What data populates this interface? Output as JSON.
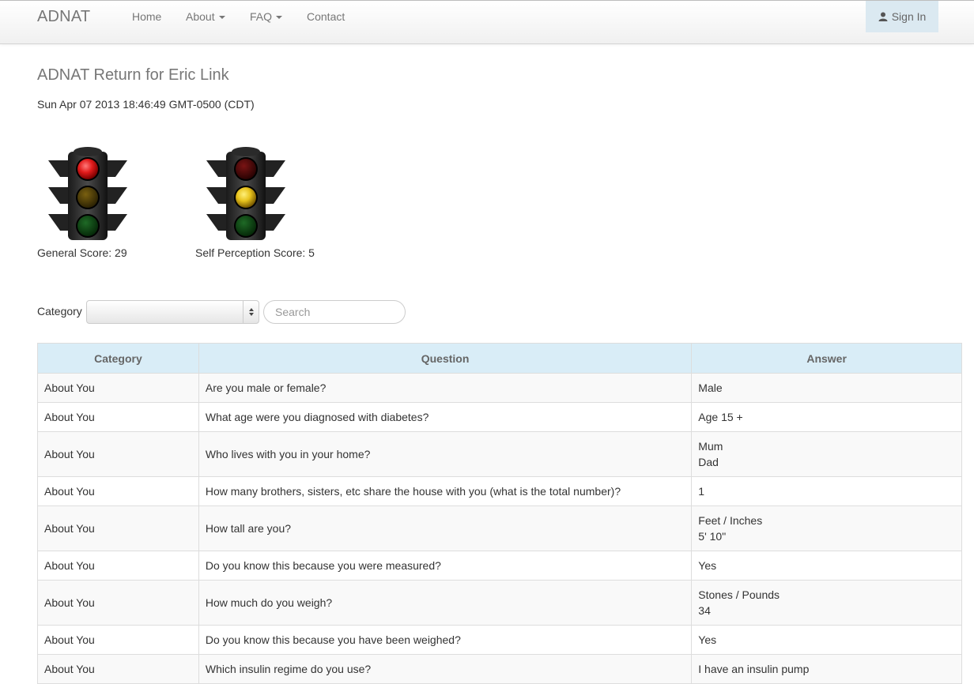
{
  "navbar": {
    "brand": "ADNAT",
    "home": "Home",
    "about": "About",
    "faq": "FAQ",
    "contact": "Contact",
    "sign_in": "Sign In"
  },
  "page": {
    "title": "ADNAT Return for Eric Link",
    "timestamp": "Sun Apr 07 2013 18:46:49 GMT-0500 (CDT)"
  },
  "scores": {
    "general": {
      "label": "General Score: 29",
      "active_light": "red"
    },
    "self_perception": {
      "label": "Self Perception Score: 5",
      "active_light": "amber"
    }
  },
  "colors": {
    "red_on": "#e11b1b",
    "amber_on": "#e7c21c",
    "green_off": "#0a4a13",
    "table_header_bg": "#d9edf7",
    "sign_in_bg": "#dbe9f1"
  },
  "filters": {
    "category_label": "Category",
    "category_selected": "",
    "search_placeholder": "Search"
  },
  "table": {
    "headers": [
      "Category",
      "Question",
      "Answer"
    ],
    "rows": [
      {
        "category": "About You",
        "question": "Are you male or female?",
        "answer": [
          "Male"
        ]
      },
      {
        "category": "About You",
        "question": "What age were you diagnosed with diabetes?",
        "answer": [
          "Age 15 +"
        ]
      },
      {
        "category": "About You",
        "question": "Who lives with you in your home?",
        "answer": [
          "Mum",
          "Dad"
        ]
      },
      {
        "category": "About You",
        "question": "How many brothers, sisters, etc share the house with you (what is the total number)?",
        "answer": [
          "1"
        ]
      },
      {
        "category": "About You",
        "question": "How tall are you?",
        "answer": [
          "Feet / Inches",
          "5' 10\""
        ]
      },
      {
        "category": "About You",
        "question": "Do you know this because you were measured?",
        "answer": [
          "Yes"
        ]
      },
      {
        "category": "About You",
        "question": "How much do you weigh?",
        "answer": [
          "Stones / Pounds",
          "34"
        ]
      },
      {
        "category": "About You",
        "question": "Do you know this because you have been weighed?",
        "answer": [
          "Yes"
        ]
      },
      {
        "category": "About You",
        "question": "Which insulin regime do you use?",
        "answer": [
          "I have an insulin pump"
        ]
      }
    ]
  }
}
